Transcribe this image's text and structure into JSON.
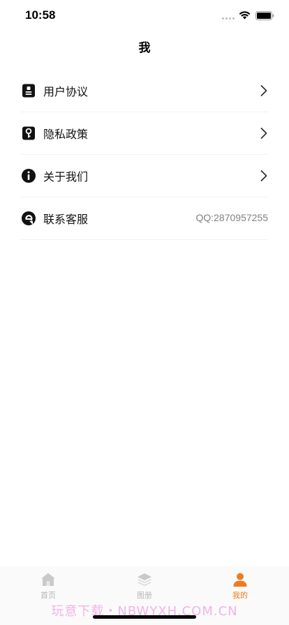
{
  "status_bar": {
    "time": "10:58",
    "icons": [
      "cellular-dots-icon",
      "wifi-icon",
      "battery-icon"
    ]
  },
  "nav": {
    "title": "我"
  },
  "menu": {
    "items": [
      {
        "label": "用户协议",
        "icon": "document-icon",
        "accessory": "chevron-right-icon"
      },
      {
        "label": "隐私政策",
        "icon": "key-icon",
        "accessory": "chevron-right-icon"
      },
      {
        "label": "关于我们",
        "icon": "info-icon",
        "accessory": "chevron-right-icon"
      },
      {
        "label": "联系客服",
        "icon": "contact-icon",
        "value": "QQ:2870957255"
      }
    ]
  },
  "tab_bar": {
    "tabs": [
      {
        "label": "首页",
        "icon": "home-icon",
        "active": false
      },
      {
        "label": "图册",
        "icon": "layers-icon",
        "active": false
      },
      {
        "label": "我的",
        "icon": "person-icon",
        "active": true
      }
    ]
  },
  "watermark": "玩意下载・NBWYXH.COM.CN",
  "colors": {
    "accent": "#f07a1e",
    "inactive_tab": "#b5b5b5",
    "value_text": "#808080",
    "divider": "#f1f1f1"
  }
}
